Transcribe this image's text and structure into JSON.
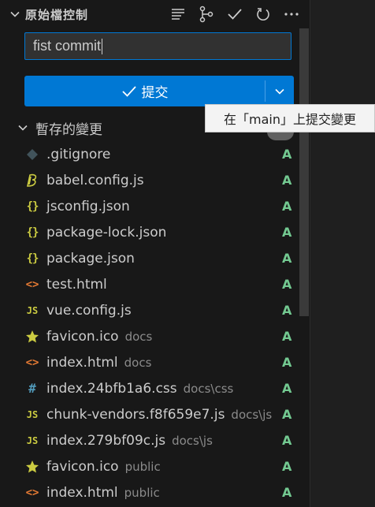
{
  "header": {
    "title": "原始檔控制",
    "actions": [
      {
        "icon": "view-as-list-icon"
      },
      {
        "icon": "branch-graph-icon"
      },
      {
        "icon": "checkmark-icon"
      },
      {
        "icon": "refresh-icon"
      },
      {
        "icon": "more-icon"
      }
    ]
  },
  "commit": {
    "message": "fist commit",
    "button_label": "提交",
    "tooltip": "在「main」上提交變更"
  },
  "staged": {
    "label": "暫存的變更"
  },
  "files": [
    {
      "name": ".gitignore",
      "dir": "",
      "icon": "gitignore-icon",
      "status": "A"
    },
    {
      "name": "babel.config.js",
      "dir": "",
      "icon": "babel-icon",
      "status": "A"
    },
    {
      "name": "jsconfig.json",
      "dir": "",
      "icon": "json-icon",
      "status": "A"
    },
    {
      "name": "package-lock.json",
      "dir": "",
      "icon": "json-icon",
      "status": "A"
    },
    {
      "name": "package.json",
      "dir": "",
      "icon": "json-icon",
      "status": "A"
    },
    {
      "name": "test.html",
      "dir": "",
      "icon": "html-icon",
      "status": "A"
    },
    {
      "name": "vue.config.js",
      "dir": "",
      "icon": "js-icon",
      "status": "A"
    },
    {
      "name": "favicon.ico",
      "dir": "docs",
      "icon": "favicon-icon",
      "status": "A"
    },
    {
      "name": "index.html",
      "dir": "docs",
      "icon": "html-icon",
      "status": "A"
    },
    {
      "name": "index.24bfb1a6.css",
      "dir": "docs\\css",
      "icon": "css-icon",
      "status": "A"
    },
    {
      "name": "chunk-vendors.f8f659e7.js",
      "dir": "docs\\js",
      "icon": "js-icon",
      "status": "A"
    },
    {
      "name": "index.279bf09c.js",
      "dir": "docs\\js",
      "icon": "js-icon",
      "status": "A"
    },
    {
      "name": "favicon.ico",
      "dir": "public",
      "icon": "favicon-icon",
      "status": "A"
    },
    {
      "name": "index.html",
      "dir": "public",
      "icon": "html-icon",
      "status": "A"
    }
  ],
  "colors": {
    "accent": "#0078d4",
    "added": "#73c991",
    "json": "#cbcb41",
    "html": "#e37933",
    "css": "#519aba",
    "git": "#41535b",
    "star": "#cbcb41"
  }
}
